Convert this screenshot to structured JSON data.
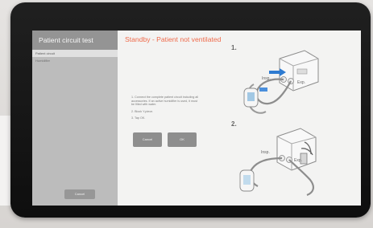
{
  "sidebar": {
    "title": "Patient circuit test",
    "items": [
      "Patient circuit",
      "Humidifier"
    ],
    "cancel_label": "Cancel"
  },
  "main": {
    "status_title": "Standby - Patient not ventilated",
    "instructions": [
      "1. Connect the complete patient circuit including all accessories. If an active humidifier is used, it must be filled with water.",
      "2. Block Y-piece.",
      "3. Tap OK."
    ],
    "cancel_label": "Cancel",
    "ok_label": "OK"
  },
  "diagram": {
    "step1_label": "1.",
    "step2_label": "2.",
    "insp_label": "Insp.",
    "exp_label": "Exp."
  },
  "colors": {
    "title_accent": "#ef6b4c",
    "sidebar_header": "#949494",
    "sidebar_bg": "#bcbcbc",
    "screen_bg": "#f3f3f2",
    "button_bg": "#8e8e8e"
  }
}
